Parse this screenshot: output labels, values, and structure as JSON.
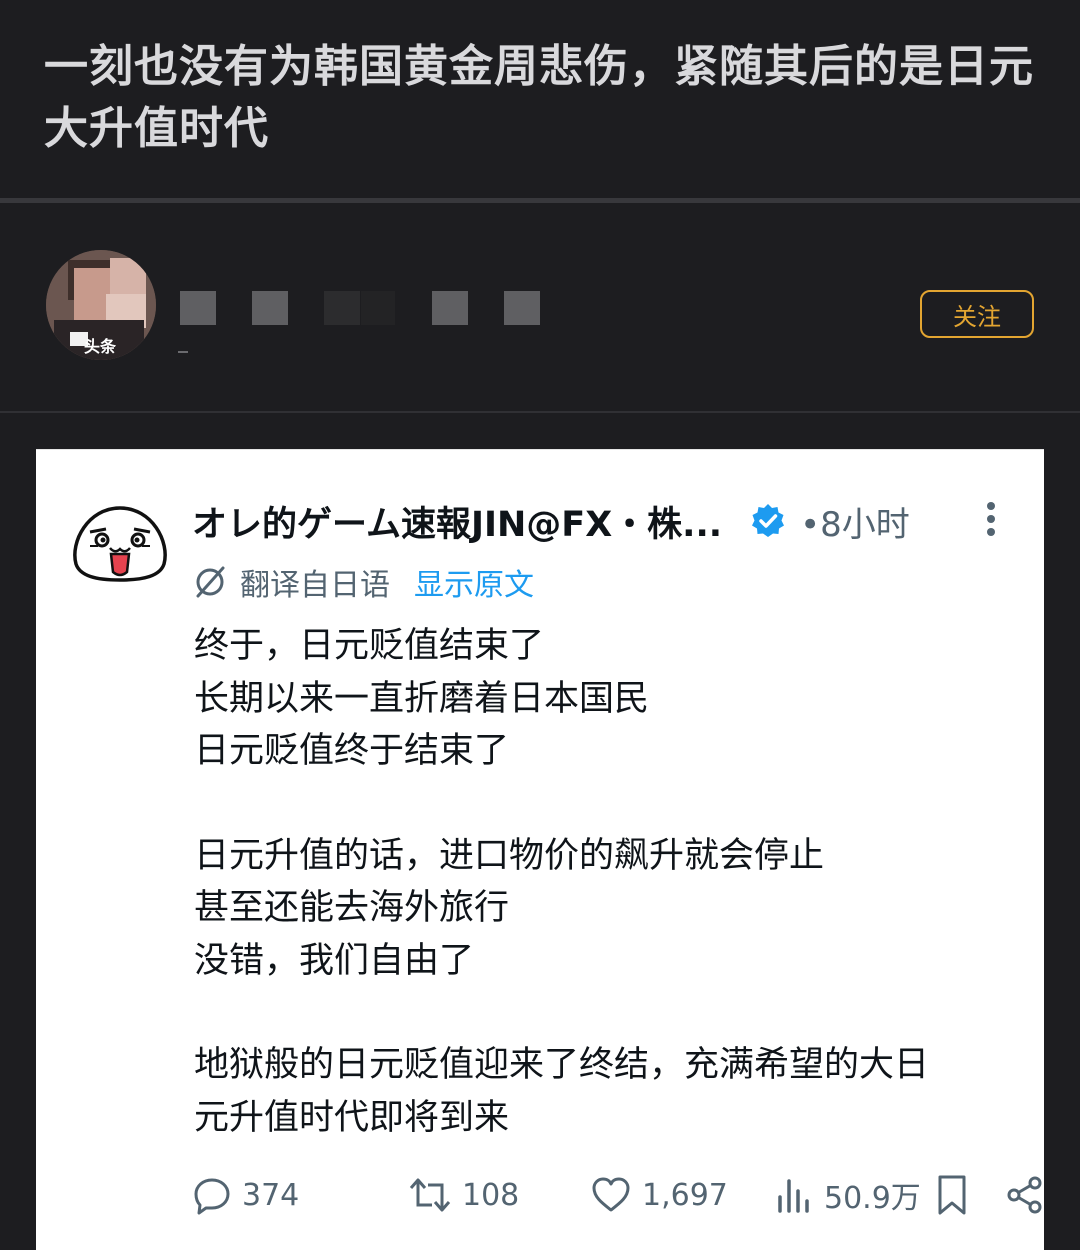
{
  "post": {
    "title": "一刻也没有为韩国黄金周悲伤，紧随其后的是日元大升值时代"
  },
  "author": {
    "avatar_tag": "头条",
    "follow_label": "关注"
  },
  "tweet": {
    "display_name": "オレ的ゲーム速報JIN@FX・株...",
    "time": "•8小时",
    "translated_label": "翻译自日语",
    "show_original_label": "显示原文",
    "paragraphs": [
      [
        "终于，日元贬值结束了",
        "长期以来一直折磨着日本国民",
        "日元贬值终于结束了"
      ],
      [
        "日元升值的话，进口物价的飙升就会停止",
        "甚至还能去海外旅行",
        "没错，我们自由了"
      ],
      [
        "地狱般的日元贬值迎来了终结，充满希望的大日",
        "元升值时代即将到来"
      ]
    ],
    "stats": {
      "replies": "374",
      "retweets": "108",
      "likes": "1,697",
      "views": "50.9万"
    }
  },
  "colors": {
    "background": "#1d1d20",
    "follow_accent": "#e3a531",
    "link_blue": "#1d9bf0",
    "muted": "#536471"
  },
  "icons": [
    "reply-icon",
    "retweet-icon",
    "like-icon",
    "views-icon",
    "bookmark-icon",
    "share-icon",
    "verified-icon",
    "translate-icon",
    "more-icon"
  ]
}
